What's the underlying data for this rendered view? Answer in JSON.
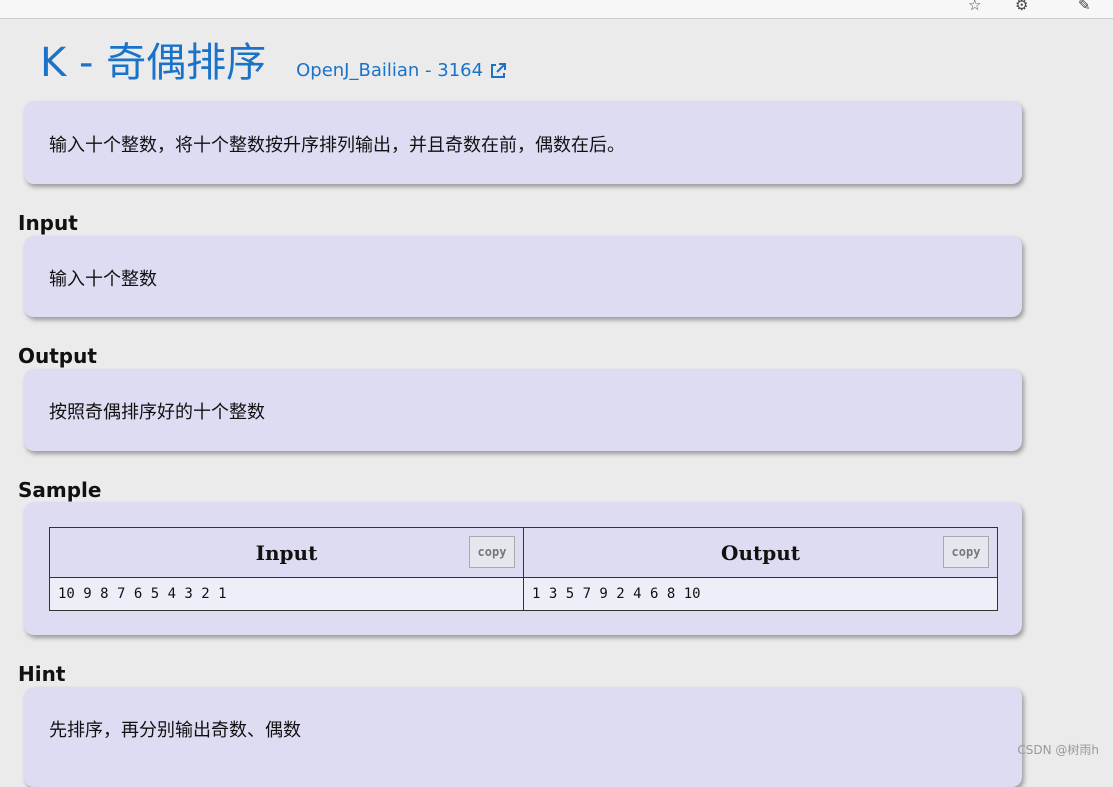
{
  "problem": {
    "title": "K - 奇偶排序",
    "source_link": "OpenJ_Bailian - 3164",
    "description": "输入十个整数，将十个整数按升序排列输出，并且奇数在前，偶数在后。"
  },
  "sections": {
    "input": {
      "heading": "Input",
      "body": "输入十个整数"
    },
    "output": {
      "heading": "Output",
      "body": "按照奇偶排序好的十个整数"
    },
    "sample": {
      "heading": "Sample",
      "input_header": "Input",
      "output_header": "Output",
      "copy_label": "copy",
      "input_value": "10 9 8 7 6 5 4 3 2 1",
      "output_value": "1 3 5 7 9 2 4 6 8 10"
    },
    "hint": {
      "heading": "Hint",
      "body": "先排序，再分别输出奇数、偶数"
    }
  },
  "watermark": "CSDN @树雨h",
  "colors": {
    "accent": "#1a73c9",
    "card": "#dddcf2",
    "background": "#ebebeb"
  }
}
